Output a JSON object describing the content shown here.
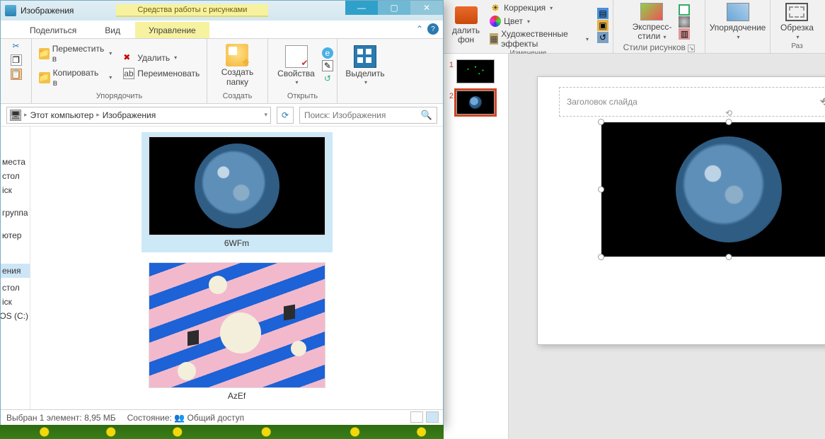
{
  "explorer": {
    "title": "Изображения",
    "context_tab": "Средства работы с рисунками",
    "tabs": {
      "share": "Поделиться",
      "view": "Вид",
      "manage": "Управление"
    },
    "ribbon": {
      "clipboard": {
        "label": ""
      },
      "organize": {
        "label": "Упорядочить",
        "move": "Переместить в",
        "copy": "Копировать в",
        "delete": "Удалить",
        "rename": "Переименовать"
      },
      "create": {
        "label": "Создать",
        "new_folder_l1": "Создать",
        "new_folder_l2": "папку"
      },
      "open": {
        "label": "Открыть",
        "properties": "Свойства"
      },
      "select": {
        "label": "",
        "select_l1": "Выделить"
      }
    },
    "address": {
      "root": "Этот компьютер",
      "current": "Изображения"
    },
    "search_placeholder": "Поиск: Изображения",
    "sidebar": {
      "i0": "места",
      "i1": "стол",
      "i2": "іск",
      "i3": "группа",
      "i4": "ютер",
      "i5": "ения",
      "i6": "стол",
      "i7": "іск",
      "i8": "OS (C:)"
    },
    "files": {
      "f0": "6WFm",
      "f1": "AzEf"
    },
    "status": {
      "selected": "Выбран 1 элемент: 8,95 МБ",
      "state_prefix": "Состояние:",
      "state_value": "Общий доступ"
    }
  },
  "pp": {
    "ribbon": {
      "remove_bg_l1": "далить",
      "remove_bg_l2": "фон",
      "correction": "Коррекция",
      "color": "Цвет",
      "effects": "Художественные эффекты",
      "change_label": "Изменение",
      "styles_l1": "Экспресс-",
      "styles_l2": "стили",
      "styles_label": "Стили рисунков",
      "arrange": "Упорядочение",
      "crop": "Обрезка",
      "size_label": "Раз"
    },
    "thumbs": {
      "n1": "1",
      "n2": "2"
    },
    "slide": {
      "title_placeholder": "Заголовок слайда"
    }
  }
}
